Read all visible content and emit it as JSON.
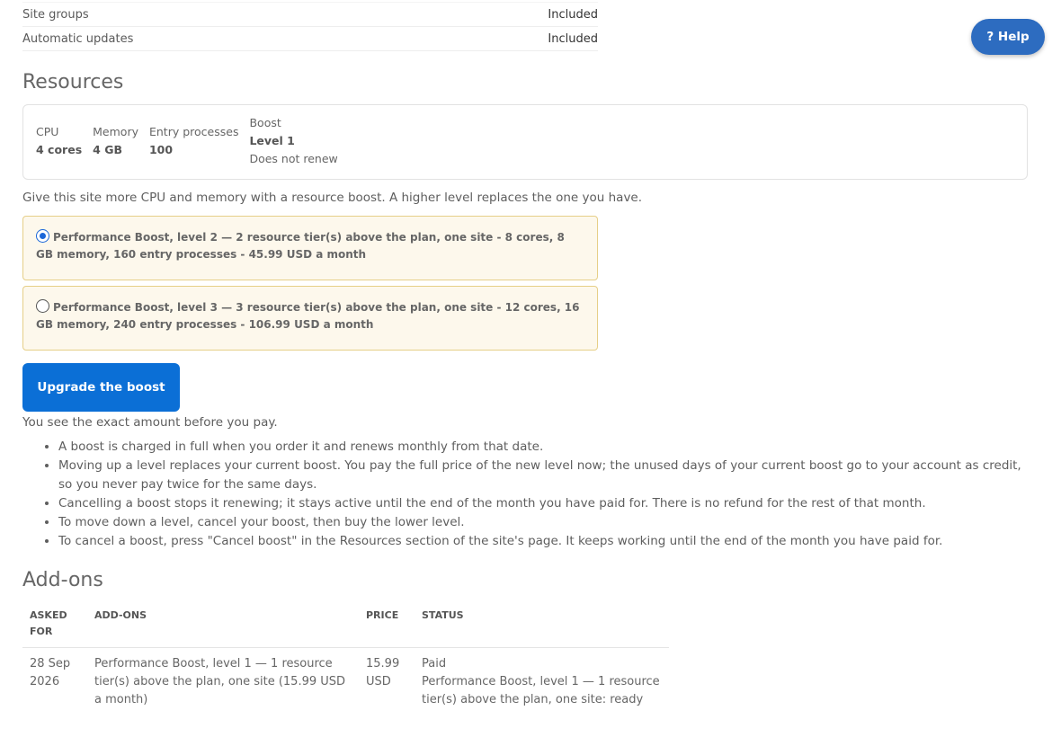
{
  "features": [
    {
      "label": "Site groups",
      "value": "Included"
    },
    {
      "label": "Automatic updates",
      "value": "Included"
    }
  ],
  "resources": {
    "title": "Resources",
    "cpu": {
      "label": "CPU",
      "value": "4 cores"
    },
    "memory": {
      "label": "Memory",
      "value": "4 GB"
    },
    "entry": {
      "label": "Entry processes",
      "value": "100"
    },
    "boost": {
      "label": "Boost",
      "value": "Level 1",
      "sub": "Does not renew"
    },
    "intro": "Give this site more CPU and memory with a resource boost. A higher level replaces the one you have."
  },
  "options": [
    {
      "text": "Performance Boost, level 2 — 2 resource tier(s) above the plan, one site - 8 cores, 8 GB memory, 160 entry processes - 45.99 USD a month",
      "selected": true
    },
    {
      "text": "Performance Boost, level 3 — 3 resource tier(s) above the plan, one site - 12 cores, 16 GB memory, 240 entry processes - 106.99 USD a month",
      "selected": false
    }
  ],
  "upgrade_button": "Upgrade the boost",
  "pay_note": "You see the exact amount before you pay.",
  "bullets": [
    "A boost is charged in full when you order it and renews monthly from that date.",
    "Moving up a level replaces your current boost. You pay the full price of the new level now; the unused days of your current boost go to your account as credit, so you never pay twice for the same days.",
    "Cancelling a boost stops it renewing; it stays active until the end of the month you have paid for. There is no refund for the rest of that month.",
    "To move down a level, cancel your boost, then buy the lower level.",
    "To cancel a boost, press \"Cancel boost\" in the Resources section of the site's page. It keeps working until the end of the month you have paid for."
  ],
  "addons": {
    "title": "Add-ons",
    "headers": {
      "asked": "ASKED FOR",
      "addon": "ADD-ONS",
      "price": "PRICE",
      "status": "STATUS"
    },
    "rows": [
      {
        "date": "28 Sep 2026",
        "addon": "Performance Boost, level 1 — 1 resource tier(s) above the plan, one site (15.99 USD a month)",
        "price": "15.99 USD",
        "status_main": "Paid",
        "status_detail": "Performance Boost, level 1 — 1 resource tier(s) above the plan, one site: ready"
      }
    ]
  },
  "help": {
    "icon": "?",
    "label": "Help"
  },
  "colors": {
    "primary": "#0b6fd6",
    "help": "#2d6cc0",
    "option_bg": "#fdf8ec",
    "option_border": "#e6cf88"
  }
}
